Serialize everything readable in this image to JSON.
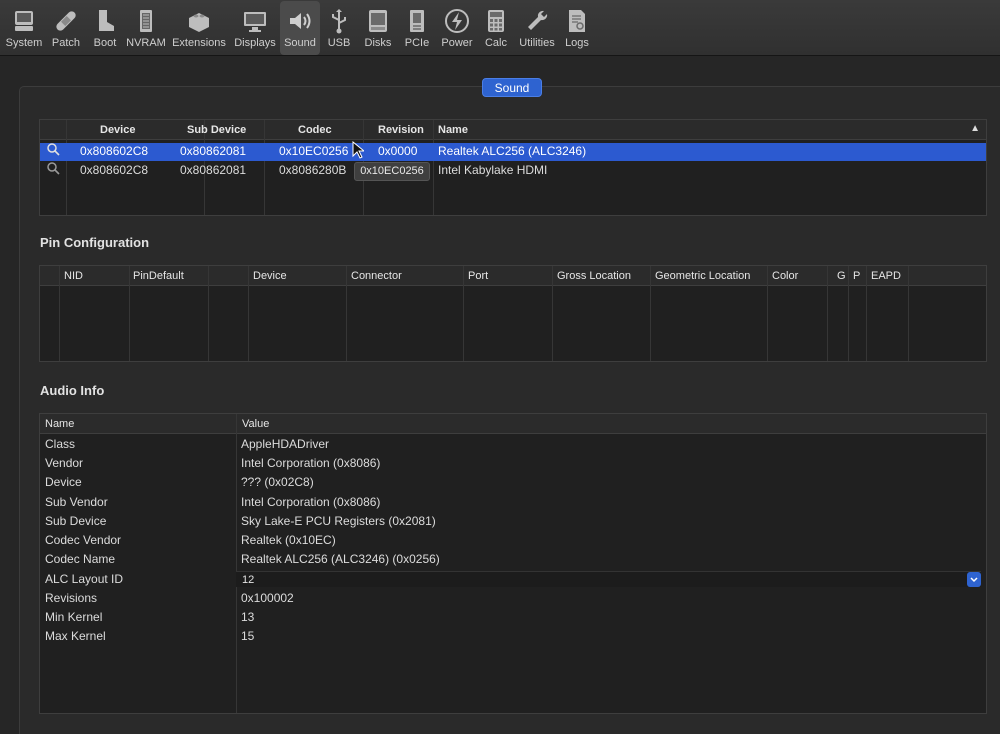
{
  "toolbar": {
    "items": [
      {
        "label": "System",
        "icon": "computer-icon"
      },
      {
        "label": "Patch",
        "icon": "bandage-icon"
      },
      {
        "label": "Boot",
        "icon": "boot-icon"
      },
      {
        "label": "NVRAM",
        "icon": "chip-icon"
      },
      {
        "label": "Extensions",
        "icon": "lego-brick-icon"
      },
      {
        "label": "Displays",
        "icon": "monitor-icon"
      },
      {
        "label": "Sound",
        "icon": "speaker-icon",
        "active": true
      },
      {
        "label": "USB",
        "icon": "usb-icon"
      },
      {
        "label": "Disks",
        "icon": "disk-icon"
      },
      {
        "label": "PCIe",
        "icon": "pcie-card-icon"
      },
      {
        "label": "Power",
        "icon": "lightning-icon"
      },
      {
        "label": "Calc",
        "icon": "calculator-icon"
      },
      {
        "label": "Utilities",
        "icon": "wrench-icon"
      },
      {
        "label": "Logs",
        "icon": "log-document-icon"
      }
    ]
  },
  "section_label": "Sound",
  "devices_table": {
    "headers": [
      "Device",
      "Sub Device",
      "Codec",
      "Revision",
      "Name"
    ],
    "rows": [
      {
        "device": "0x808602C8",
        "sub_device": "0x80862081",
        "codec": "0x10EC0256",
        "revision": "0x0000",
        "name": "Realtek ALC256 (ALC3246)",
        "selected": true
      },
      {
        "device": "0x808602C8",
        "sub_device": "0x80862081",
        "codec": "0x8086280B",
        "revision": "",
        "name": "Intel Kabylake HDMI",
        "selected": false
      }
    ],
    "tooltip": "0x10EC0256"
  },
  "pin_config": {
    "title": "Pin Configuration",
    "headers": [
      "NID",
      "PinDefault",
      "",
      "Device",
      "Connector",
      "Port",
      "Gross Location",
      "Geometric Location",
      "Color",
      "G",
      "P",
      "EAPD"
    ]
  },
  "audio_info": {
    "title": "Audio Info",
    "headers": [
      "Name",
      "Value"
    ],
    "rows": [
      {
        "name": "Class",
        "value": "AppleHDADriver"
      },
      {
        "name": "Vendor",
        "value": "Intel Corporation (0x8086)"
      },
      {
        "name": "Device",
        "value": "??? (0x02C8)"
      },
      {
        "name": "Sub Vendor",
        "value": "Intel Corporation (0x8086)"
      },
      {
        "name": "Sub Device",
        "value": "Sky Lake-E PCU Registers (0x2081)"
      },
      {
        "name": "Codec Vendor",
        "value": "Realtek (0x10EC)"
      },
      {
        "name": "Codec Name",
        "value": "Realtek ALC256 (ALC3246) (0x0256)"
      },
      {
        "name": "ALC Layout ID",
        "value": "12"
      },
      {
        "name": "Revisions",
        "value": "0x100002"
      },
      {
        "name": "Min Kernel",
        "value": "13"
      },
      {
        "name": "Max Kernel",
        "value": "15"
      }
    ]
  },
  "colors": {
    "accent": "#2e63d0",
    "background": "#262626",
    "selection": "#2c5ad0"
  }
}
